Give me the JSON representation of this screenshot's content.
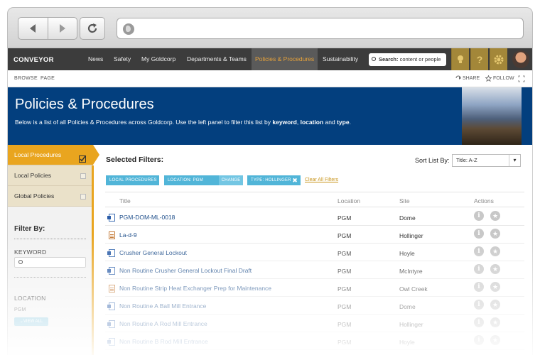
{
  "header": {
    "logo": "CONVEYOR",
    "nav": [
      "News",
      "Safety",
      "My Goldcorp",
      "Departments & Teams",
      "Policies & Procedures",
      "Sustainability"
    ],
    "active_nav": "Policies & Procedures",
    "search_label": "Search:",
    "search_placeholder": "content or people",
    "icons": [
      "lightbulb-icon",
      "question-icon",
      "gear-icon"
    ],
    "question_glyph": "?"
  },
  "browse_bar": {
    "links": [
      "BROWSE",
      "PAGE"
    ],
    "share": "SHARE",
    "follow": "FOLLOW"
  },
  "hero": {
    "title": "Policies & Procedures",
    "description_prefix": "Below is a list of all Policies & Procedures across Goldcorp. Use the left panel to filter this list by ",
    "keyword": "keyword",
    "sep": ", ",
    "location": "location",
    "and": " and ",
    "type": "type",
    "end": "."
  },
  "left_panel": {
    "tabs": [
      {
        "label": "Local Procedures",
        "active": true
      },
      {
        "label": "Local Policies",
        "active": false
      },
      {
        "label": "Global Policies",
        "active": false
      }
    ],
    "filter_title": "Filter By:",
    "keyword_label": "KEYWORD",
    "keyword_value": "",
    "location_label": "LOCATION",
    "location_value": "PGM",
    "view_all": "VIEW ALL"
  },
  "main": {
    "selected_filters_title": "Selected Filters:",
    "sort_label": "Sort List By:",
    "sort_value": "Title: A-Z",
    "filters": [
      {
        "label": "LOCAL PROCEDURES"
      },
      {
        "label": "LOCATION: PGM",
        "action": "CHANGE"
      },
      {
        "label": "TYPE: HOLLINGER",
        "remove": "✖"
      }
    ],
    "clear_all": "Clear All Filters",
    "columns": [
      "Title",
      "Location",
      "Site",
      "Actions"
    ],
    "rows": [
      {
        "title": "PGM-DOM-ML-0018",
        "location": "PGM",
        "site": "Dome",
        "icon": "word"
      },
      {
        "title": "La-d-9",
        "location": "PGM",
        "site": "Hollinger",
        "icon": "pdf"
      },
      {
        "title": "Crusher General Lockout",
        "location": "PGM",
        "site": "Hoyle",
        "icon": "word"
      },
      {
        "title": "Non Routine Crusher General Lockout Final Draft",
        "location": "PGM",
        "site": "McIntyre",
        "icon": "word"
      },
      {
        "title": "Non Routine Strip Heat Exchanger Prep for Maintenance",
        "location": "PGM",
        "site": "Owl Creek",
        "icon": "pdf"
      },
      {
        "title": "Non Routine A Ball Mill Entrance",
        "location": "PGM",
        "site": "Dome",
        "icon": "word"
      },
      {
        "title": "Non Routine A Rod Mill Entrance",
        "location": "PGM",
        "site": "Hollinger",
        "icon": "word"
      },
      {
        "title": "Non Routine B Rod Mill Entrance",
        "location": "PGM",
        "site": "Hoyle",
        "icon": "word"
      }
    ]
  }
}
